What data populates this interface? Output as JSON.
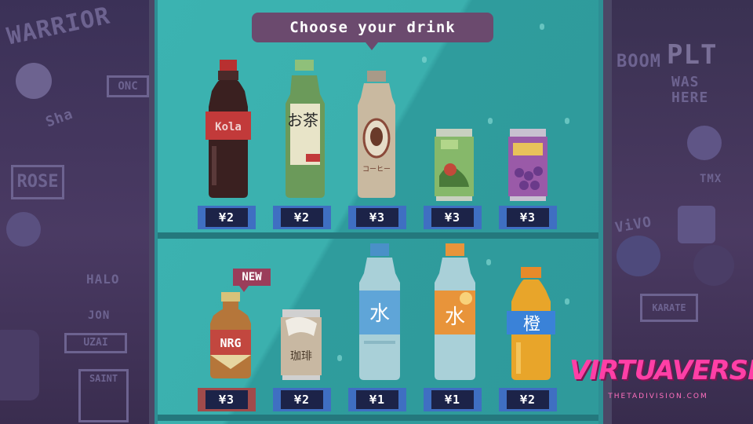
{
  "prompt": "Choose your drink",
  "new_badge": "NEW",
  "logo": {
    "title": "VIRTUAVERSE",
    "subtitle": "THETADIVISION.COM"
  },
  "wall_left": {
    "tags": [
      "WARRIOR",
      "ONC",
      "ROSE",
      "HALO",
      "UZAI",
      "SAINT",
      "Sha",
      "JON"
    ]
  },
  "wall_right": {
    "tags": [
      "BOOM",
      "PLT",
      "WAS",
      "HERE",
      "TMX",
      "KARATE",
      "ViVO"
    ]
  },
  "drinks_top": [
    {
      "name": "cola-bottle",
      "label": "Kola",
      "price": "¥2",
      "colors": {
        "body": "#3a2020",
        "label": "#c23a3a",
        "cap": "#b83030"
      }
    },
    {
      "name": "green-tea-bottle",
      "label": "お茶",
      "price": "¥2",
      "colors": {
        "body": "#6b9a5a",
        "label": "#e8e4c8",
        "cap": "#8fc07a"
      }
    },
    {
      "name": "coffee-bottle",
      "label": "コーヒー",
      "price": "¥3",
      "colors": {
        "body": "#c9b9a0",
        "label": "#e6dcc8",
        "cap": "#a89a88"
      }
    },
    {
      "name": "green-can",
      "label": "",
      "price": "¥3",
      "colors": {
        "body": "#86b86a",
        "label": "#b2d68a",
        "cap": "#c8d0c0"
      }
    },
    {
      "name": "grape-can",
      "label": "",
      "price": "¥3",
      "colors": {
        "body": "#9a5aa8",
        "label": "#b474c0",
        "cap": "#c8c0d0"
      }
    }
  ],
  "drinks_bottom": [
    {
      "name": "nrg-bottle",
      "label": "NRG",
      "price": "¥3",
      "selected": true,
      "colors": {
        "body": "#b5763a",
        "label": "#c2473f",
        "cap": "#d8c27a"
      }
    },
    {
      "name": "milk-tea-can",
      "label": "珈琲",
      "price": "¥2",
      "colors": {
        "body": "#c8b8a2",
        "label": "#f0ece4",
        "cap": "#d0d0d0"
      }
    },
    {
      "name": "water-bottle-blue",
      "label": "水",
      "price": "¥1",
      "colors": {
        "body": "#a9d0d8",
        "label": "#5fa5d8",
        "cap": "#4a90c8"
      }
    },
    {
      "name": "water-bottle-orange",
      "label": "水",
      "price": "¥1",
      "colors": {
        "body": "#a9d0d8",
        "label": "#e8943a",
        "cap": "#e8943a"
      }
    },
    {
      "name": "orange-soda-bottle",
      "label": "橙",
      "price": "¥2",
      "colors": {
        "body": "#e8a52a",
        "label": "#3a82d8",
        "cap": "#e88a2a"
      }
    }
  ]
}
